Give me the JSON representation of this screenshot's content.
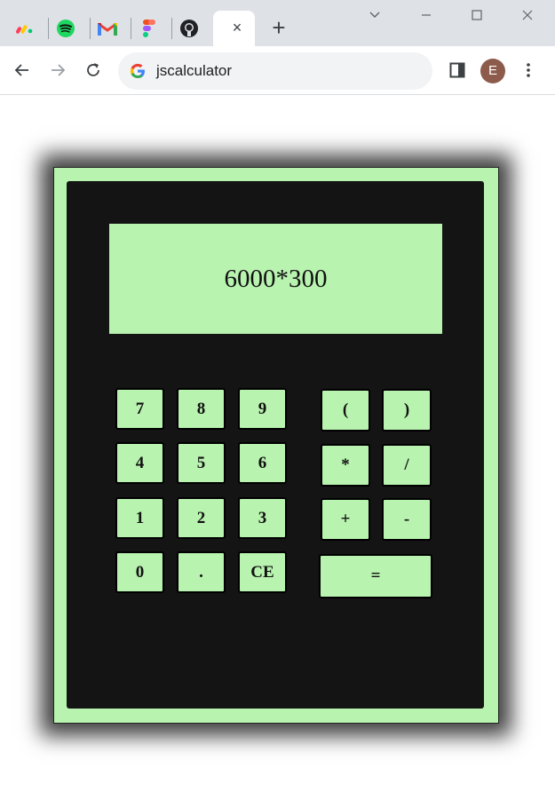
{
  "browser": {
    "tabs": [
      {
        "icon": "monday-icon"
      },
      {
        "icon": "spotify-icon"
      },
      {
        "icon": "gmail-icon"
      },
      {
        "icon": "figma-icon"
      },
      {
        "icon": "github-icon"
      }
    ],
    "active_tab_close": "×",
    "new_tab": "+",
    "address": "jscalculator",
    "profile_initial": "E"
  },
  "calculator": {
    "display": "6000*300",
    "digits": {
      "k7": "7",
      "k8": "8",
      "k9": "9",
      "k4": "4",
      "k5": "5",
      "k6": "6",
      "k1": "1",
      "k2": "2",
      "k3": "3",
      "k0": "0",
      "dot": ".",
      "ce": "CE"
    },
    "operators": {
      "lparen": "(",
      "rparen": ")",
      "multiply": "*",
      "divide": "/",
      "plus": "+",
      "minus": "-",
      "equals": "="
    },
    "colors": {
      "panel": "#b9f3b0",
      "body": "#141414"
    }
  }
}
